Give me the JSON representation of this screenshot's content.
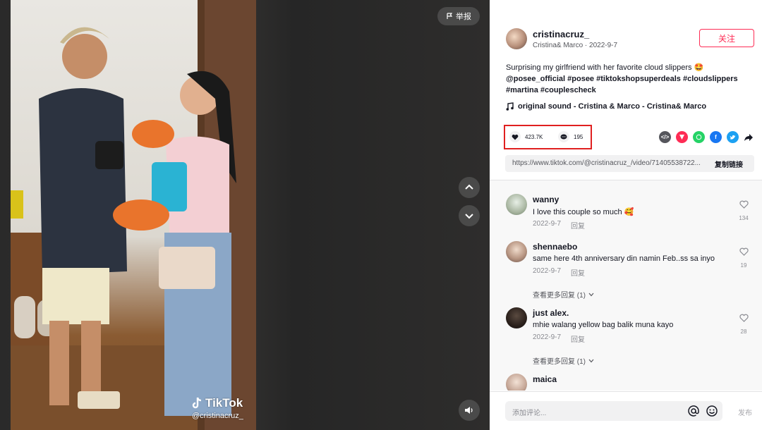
{
  "video": {
    "report_label": "举报",
    "watermark_brand": "TikTok",
    "watermark_user": "@cristinacruz_"
  },
  "author": {
    "username": "cristinacruz_",
    "subtitle": "Cristina& Marco · 2022-9-7",
    "follow_label": "关注"
  },
  "description": {
    "text": "Surprising my girlfriend with her favorite cloud slippers 🤩",
    "tags": "@posee_official #posee #tiktokshopsuperdeals #cloudslippers #martina #couplescheck"
  },
  "music": {
    "title": "original sound - Cristina & Marco - Cristina& Marco"
  },
  "stats": {
    "likes": "423.7K",
    "comments": "195"
  },
  "share": {
    "icons": [
      "embed-icon",
      "send-icon",
      "whatsapp-icon",
      "facebook-icon",
      "twitter-icon",
      "share-arrow-icon"
    ],
    "colors": {
      "embed": "#55565c",
      "send": "#fe2c55",
      "whatsapp": "#25d366",
      "facebook": "#1877f2",
      "twitter": "#1da1f2"
    }
  },
  "link": {
    "url": "https://www.tiktok.com/@cristinacruz_/video/71405538722...",
    "copy_label": "复制链接"
  },
  "comments": [
    {
      "name": "wanny",
      "text": "I love this couple so much 🥰",
      "date": "2022-9-7",
      "reply": "回复",
      "likes": "134"
    },
    {
      "name": "shennaebo",
      "text": "same here 4th anniversary din namin Feb..ss sa inyo",
      "date": "2022-9-7",
      "reply": "回复",
      "likes": "19",
      "more": "查看更多回复 (1)"
    },
    {
      "name": "just alex.",
      "text": "mhie walang yellow bag balik muna kayo",
      "date": "2022-9-7",
      "reply": "回复",
      "likes": "28",
      "more": "查看更多回复 (1)"
    },
    {
      "name": "maica",
      "text": "",
      "date": "",
      "reply": "",
      "likes": ""
    }
  ],
  "input": {
    "placeholder": "添加评论...",
    "post_label": "发布"
  },
  "colors": {
    "accent": "#fe2c55",
    "highlight_box": "#e02020"
  }
}
